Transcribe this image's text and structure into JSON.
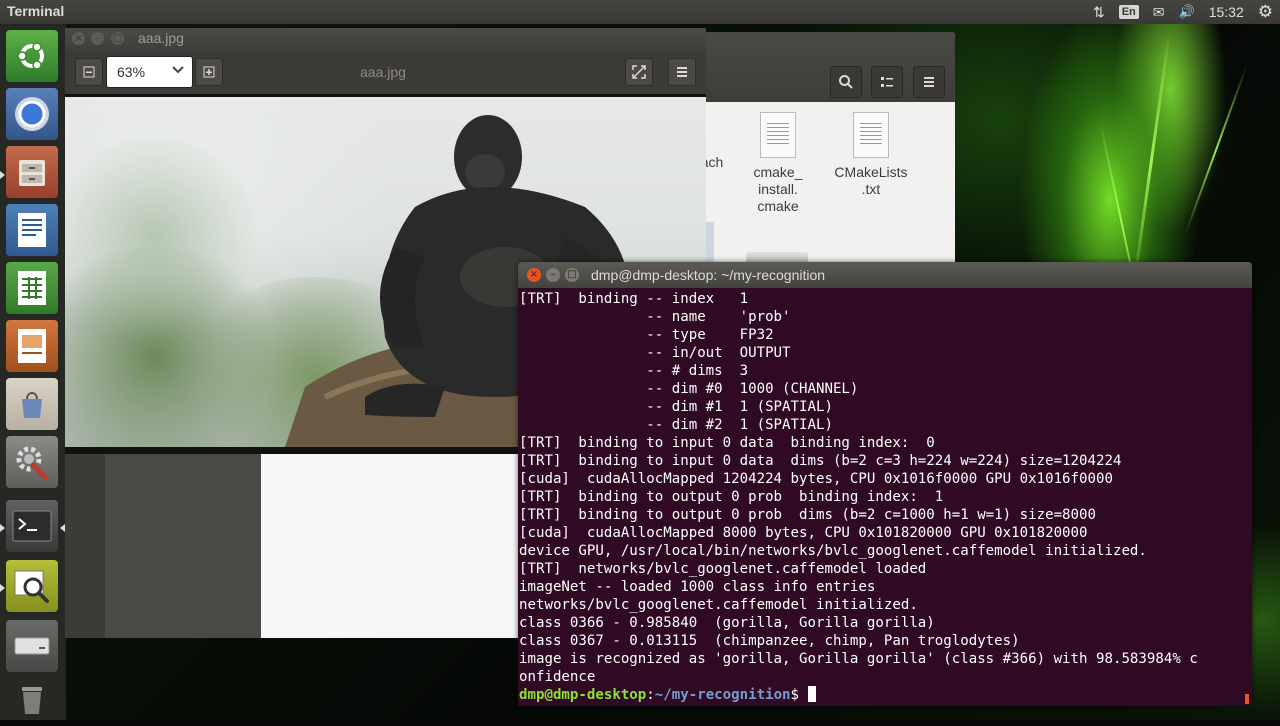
{
  "top_panel": {
    "app_name": "Terminal",
    "indicators": {
      "network": "⇅",
      "language": "En",
      "mail": "✉",
      "sound": "🔊",
      "clock": "15:32",
      "settings": "⚙"
    }
  },
  "launcher": {
    "items": [
      "dash",
      "chromium",
      "file-manager",
      "writer",
      "calc",
      "impress",
      "software-center",
      "system-settings",
      "terminal",
      "image-viewer",
      "drive",
      "trash"
    ]
  },
  "file_manager": {
    "files": [
      {
        "name": "ach",
        "icon": "doc-icon"
      },
      {
        "name": "cmake_\ninstall.\ncmake",
        "icon": "doc-icon"
      },
      {
        "name": "CMakeLists\n.txt",
        "icon": "doc-icon"
      }
    ]
  },
  "image_viewer": {
    "window_title": "aaa.jpg",
    "zoom": "63%",
    "image_name": "aaa.jpg"
  },
  "terminal": {
    "title": "dmp@dmp-desktop: ~/my-recognition",
    "lines": [
      "[TRT]  binding -- index   1",
      "               -- name    'prob'",
      "               -- type    FP32",
      "               -- in/out  OUTPUT",
      "               -- # dims  3",
      "               -- dim #0  1000 (CHANNEL)",
      "               -- dim #1  1 (SPATIAL)",
      "               -- dim #2  1 (SPATIAL)",
      "[TRT]  binding to input 0 data  binding index:  0",
      "[TRT]  binding to input 0 data  dims (b=2 c=3 h=224 w=224) size=1204224",
      "[cuda]  cudaAllocMapped 1204224 bytes, CPU 0x1016f0000 GPU 0x1016f0000",
      "[TRT]  binding to output 0 prob  binding index:  1",
      "[TRT]  binding to output 0 prob  dims (b=2 c=1000 h=1 w=1) size=8000",
      "[cuda]  cudaAllocMapped 8000 bytes, CPU 0x101820000 GPU 0x101820000",
      "device GPU, /usr/local/bin/networks/bvlc_googlenet.caffemodel initialized.",
      "[TRT]  networks/bvlc_googlenet.caffemodel loaded",
      "imageNet -- loaded 1000 class info entries",
      "networks/bvlc_googlenet.caffemodel initialized.",
      "class 0366 - 0.985840  (gorilla, Gorilla gorilla)",
      "class 0367 - 0.013115  (chimpanzee, chimp, Pan troglodytes)",
      "image is recognized as 'gorilla, Gorilla gorilla' (class #366) with 98.583984% c",
      "onfidence"
    ],
    "prompt": {
      "user_host": "dmp@dmp-desktop",
      "separator": ":",
      "path": "~/my-recognition",
      "symbol": "$ "
    }
  },
  "colors": {
    "terminal_bg": "#300a24",
    "prompt_user": "#8ae234",
    "prompt_path": "#729fcf",
    "panel_bg": "#3c3b37",
    "close_button": "#e95420"
  }
}
